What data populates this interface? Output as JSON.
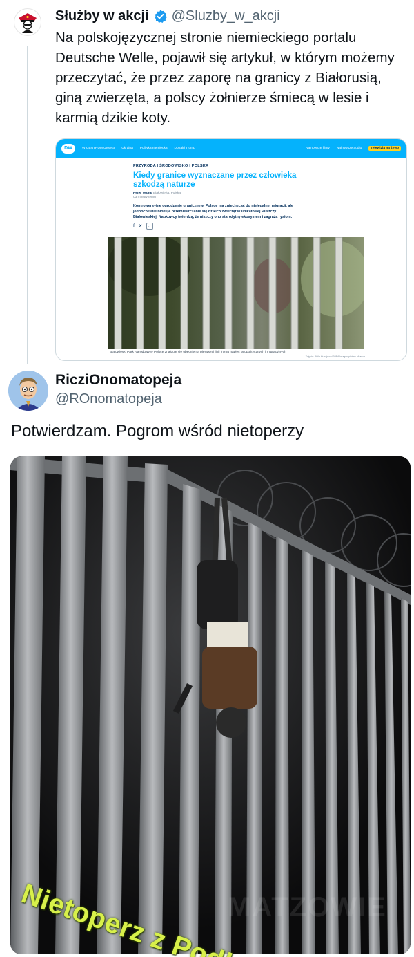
{
  "tweet1": {
    "author_name": "Służby w akcji",
    "verified_icon": "verified-badge-icon",
    "handle": "@Sluzby_w_akcji",
    "text": "Na polskojęzycznej stronie niemieckiego portalu Deutsche Welle, pojawił się artykuł, w którym możemy przeczytać, że przez zaporę na granicy z Białorusią, giną zwierzęta, a polscy żołnierze śmiecą w lesie i karmią dzikie koty."
  },
  "article": {
    "logo": "DW",
    "nav": [
      "W CENTRUM UWAGI",
      "Ukraina",
      "Polityka niemiecka",
      "Donald Trump"
    ],
    "nav_right": [
      "Najnowsze filmy",
      "Najnowsze audio"
    ],
    "live": "Telewizja na żywo",
    "category": "PRZYRODA I ŚRODOWISKO | POLSKA",
    "title": "Kiedy granice wyznaczane przez człowieka szkodzą naturze",
    "author": "Peter Yeung",
    "location": "Białowieża, Polska",
    "reading_time": "03 minuty temu",
    "lead": "Kontrowersyjne ogrodzenie graniczne w Polsce ma zniechęcać do nielegalnej migracji, ale jednocześnie blokuje przemieszczanie się dzikich zwierząt w unikatowej Puszczy Białowieskiej. Naukowcy twierdzą, że niszczy ono starożytny ekosystem i zagraża rysiom.",
    "share": [
      "f",
      "X"
    ],
    "caption": "Białowieski Park Narodowy w Polsce znajduje się obecnie na pierwszej linii frontu napięć geopolitycznych i migracyjnych",
    "credit": "Zdjęcie: Attila Husejnow/SOPA Images/picture alliance"
  },
  "tweet2": {
    "author_name": "RicziOnomatopeja",
    "handle": "@ROnomatopeja",
    "text": "Potwierdzam. Pogrom wśród nietoperzy",
    "photo_caption": "Nietoperz z Podlasia",
    "watermark": "MATZOWIE"
  },
  "colors": {
    "accent_blue": "#1d9bf0",
    "dw_blue": "#05b2fc",
    "caption_green": "#d8f04a"
  }
}
